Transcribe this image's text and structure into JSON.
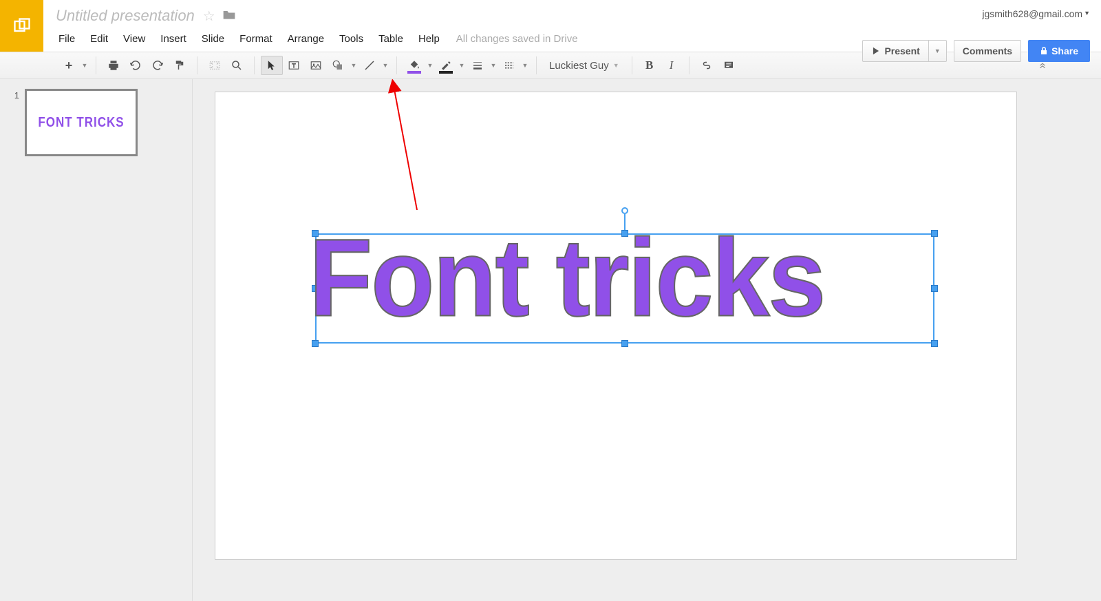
{
  "header": {
    "doc_title": "Untitled presentation",
    "user_email": "jgsmith628@gmail.com",
    "present_label": "Present",
    "comments_label": "Comments",
    "share_label": "Share",
    "save_status": "All changes saved in Drive"
  },
  "menu": {
    "file": "File",
    "edit": "Edit",
    "view": "View",
    "insert": "Insert",
    "slide": "Slide",
    "format": "Format",
    "arrange": "Arrange",
    "tools": "Tools",
    "table": "Table",
    "help": "Help"
  },
  "toolbar": {
    "font_name": "Luckiest Guy",
    "fill_color": "#9050e8",
    "line_color": "#000000"
  },
  "sidebar": {
    "slide_number": "1",
    "thumb_text": "FONT TRICKS"
  },
  "canvas": {
    "main_text": "Font tricks",
    "text_color": "#9050e8"
  }
}
